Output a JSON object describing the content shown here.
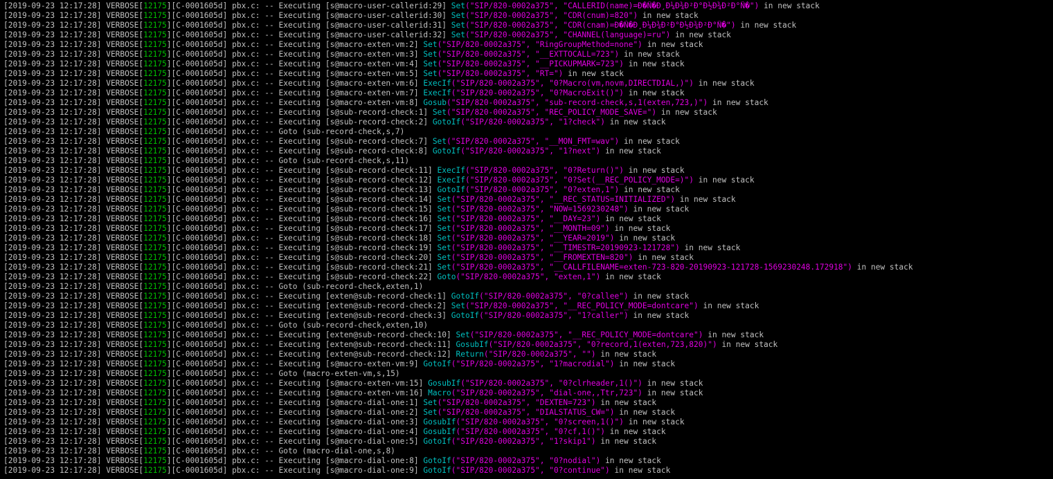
{
  "colors": {
    "background": "#000000",
    "text": "#c0c0c0",
    "pid": "#00c000",
    "command": "#00c0c0",
    "arguments": "#e000e0"
  },
  "log": {
    "timestamp": "[2019-09-23 12:17:28]",
    "level": "VERBOSE",
    "pid": "12175",
    "channel_id": "[C-0001605d]",
    "source": "pbx.c:",
    "lines": [
      {
        "type": "exec",
        "ctx": "[s@macro-user-callerid:29]",
        "cmd": "Set",
        "args": "(\"SIP/820-0002a375\", \"CALLERID(name)=Ð�Ñ�Ð¸Ð¼Ð¾Ð²Ð°Ð½Ð¾Ð²Ð°Ñ�\")"
      },
      {
        "type": "exec",
        "ctx": "[s@macro-user-callerid:30]",
        "cmd": "Set",
        "args": "(\"SIP/820-0002a375\", \"CDR(cnum)=820\")"
      },
      {
        "type": "exec",
        "ctx": "[s@macro-user-callerid:31]",
        "cmd": "Set",
        "args": "(\"SIP/820-0002a375\", \"CDR(cnam)=Ð�Ñ�Ð¸Ð¼Ð¾Ð²Ð°Ð½Ð¾Ð²Ð°Ñ�\")"
      },
      {
        "type": "exec",
        "ctx": "[s@macro-user-callerid:32]",
        "cmd": "Set",
        "args": "(\"SIP/820-0002a375\", \"CHANNEL(language)=ru\")"
      },
      {
        "type": "exec",
        "ctx": "[s@macro-exten-vm:2]",
        "cmd": "Set",
        "args": "(\"SIP/820-0002a375\", \"RingGroupMethod=none\")"
      },
      {
        "type": "exec",
        "ctx": "[s@macro-exten-vm:3]",
        "cmd": "Set",
        "args": "(\"SIP/820-0002a375\", \"__EXTTOCALL=723\")"
      },
      {
        "type": "exec",
        "ctx": "[s@macro-exten-vm:4]",
        "cmd": "Set",
        "args": "(\"SIP/820-0002a375\", \"__PICKUPMARK=723\")"
      },
      {
        "type": "exec",
        "ctx": "[s@macro-exten-vm:5]",
        "cmd": "Set",
        "args": "(\"SIP/820-0002a375\", \"RT=\")"
      },
      {
        "type": "exec",
        "ctx": "[s@macro-exten-vm:6]",
        "cmd": "ExecIf",
        "args": "(\"SIP/820-0002a375\", \"0?Macro(vm,novm,DIRECTDIAL,)\")"
      },
      {
        "type": "exec",
        "ctx": "[s@macro-exten-vm:7]",
        "cmd": "ExecIf",
        "args": "(\"SIP/820-0002a375\", \"0?MacroExit()\")"
      },
      {
        "type": "exec",
        "ctx": "[s@macro-exten-vm:8]",
        "cmd": "Gosub",
        "args": "(\"SIP/820-0002a375\", \"sub-record-check,s,1(exten,723,)\")"
      },
      {
        "type": "exec",
        "ctx": "[s@sub-record-check:1]",
        "cmd": "Set",
        "args": "(\"SIP/820-0002a375\", \"REC_POLICY_MODE_SAVE=\")"
      },
      {
        "type": "exec",
        "ctx": "[s@sub-record-check:2]",
        "cmd": "GotoIf",
        "args": "(\"SIP/820-0002a375\", \"1?check\")"
      },
      {
        "type": "goto",
        "text": "Goto (sub-record-check,s,7)"
      },
      {
        "type": "exec",
        "ctx": "[s@sub-record-check:7]",
        "cmd": "Set",
        "args": "(\"SIP/820-0002a375\", \"__MON_FMT=wav\")"
      },
      {
        "type": "exec",
        "ctx": "[s@sub-record-check:8]",
        "cmd": "GotoIf",
        "args": "(\"SIP/820-0002a375\", \"1?next\")"
      },
      {
        "type": "goto",
        "text": "Goto (sub-record-check,s,11)"
      },
      {
        "type": "exec",
        "ctx": "[s@sub-record-check:11]",
        "cmd": "ExecIf",
        "args": "(\"SIP/820-0002a375\", \"0?Return()\")"
      },
      {
        "type": "exec",
        "ctx": "[s@sub-record-check:12]",
        "cmd": "ExecIf",
        "args": "(\"SIP/820-0002a375\", \"0?Set(__REC_POLICY_MODE=)\")"
      },
      {
        "type": "exec",
        "ctx": "[s@sub-record-check:13]",
        "cmd": "GotoIf",
        "args": "(\"SIP/820-0002a375\", \"0?exten,1\")"
      },
      {
        "type": "exec",
        "ctx": "[s@sub-record-check:14]",
        "cmd": "Set",
        "args": "(\"SIP/820-0002a375\", \"__REC_STATUS=INITIALIZED\")"
      },
      {
        "type": "exec",
        "ctx": "[s@sub-record-check:15]",
        "cmd": "Set",
        "args": "(\"SIP/820-0002a375\", \"NOW=1569230248\")"
      },
      {
        "type": "exec",
        "ctx": "[s@sub-record-check:16]",
        "cmd": "Set",
        "args": "(\"SIP/820-0002a375\", \"__DAY=23\")"
      },
      {
        "type": "exec",
        "ctx": "[s@sub-record-check:17]",
        "cmd": "Set",
        "args": "(\"SIP/820-0002a375\", \"__MONTH=09\")"
      },
      {
        "type": "exec",
        "ctx": "[s@sub-record-check:18]",
        "cmd": "Set",
        "args": "(\"SIP/820-0002a375\", \"__YEAR=2019\")"
      },
      {
        "type": "exec",
        "ctx": "[s@sub-record-check:19]",
        "cmd": "Set",
        "args": "(\"SIP/820-0002a375\", \"__TIMESTR=20190923-121728\")"
      },
      {
        "type": "exec",
        "ctx": "[s@sub-record-check:20]",
        "cmd": "Set",
        "args": "(\"SIP/820-0002a375\", \"__FROMEXTEN=820\")"
      },
      {
        "type": "exec",
        "ctx": "[s@sub-record-check:21]",
        "cmd": "Set",
        "args": "(\"SIP/820-0002a375\", \"__CALLFILENAME=exten-723-820-20190923-121728-1569230248.172918\")"
      },
      {
        "type": "exec",
        "ctx": "[s@sub-record-check:22]",
        "cmd": "Goto",
        "args": "(\"SIP/820-0002a375\", \"exten,1\")"
      },
      {
        "type": "goto",
        "text": "Goto (sub-record-check,exten,1)"
      },
      {
        "type": "exec",
        "ctx": "[exten@sub-record-check:1]",
        "cmd": "GotoIf",
        "args": "(\"SIP/820-0002a375\", \"0?callee\")"
      },
      {
        "type": "exec",
        "ctx": "[exten@sub-record-check:2]",
        "cmd": "Set",
        "args": "(\"SIP/820-0002a375\", \"__REC_POLICY_MODE=dontcare\")"
      },
      {
        "type": "exec",
        "ctx": "[exten@sub-record-check:3]",
        "cmd": "GotoIf",
        "args": "(\"SIP/820-0002a375\", \"1?caller\")"
      },
      {
        "type": "goto",
        "text": "Goto (sub-record-check,exten,10)"
      },
      {
        "type": "exec",
        "ctx": "[exten@sub-record-check:10]",
        "cmd": "Set",
        "args": "(\"SIP/820-0002a375\", \"__REC_POLICY_MODE=dontcare\")"
      },
      {
        "type": "exec",
        "ctx": "[exten@sub-record-check:11]",
        "cmd": "GosubIf",
        "args": "(\"SIP/820-0002a375\", \"0?record,1(exten,723,820)\")"
      },
      {
        "type": "exec",
        "ctx": "[exten@sub-record-check:12]",
        "cmd": "Return",
        "args": "(\"SIP/820-0002a375\", \"\")"
      },
      {
        "type": "exec",
        "ctx": "[s@macro-exten-vm:9]",
        "cmd": "GotoIf",
        "args": "(\"SIP/820-0002a375\", \"1?macrodial\")"
      },
      {
        "type": "goto",
        "text": "Goto (macro-exten-vm,s,15)"
      },
      {
        "type": "exec",
        "ctx": "[s@macro-exten-vm:15]",
        "cmd": "GosubIf",
        "args": "(\"SIP/820-0002a375\", \"0?clrheader,1()\")"
      },
      {
        "type": "exec",
        "ctx": "[s@macro-exten-vm:16]",
        "cmd": "Macro",
        "args": "(\"SIP/820-0002a375\", \"dial-one,,Ttr,723\")"
      },
      {
        "type": "exec",
        "ctx": "[s@macro-dial-one:1]",
        "cmd": "Set",
        "args": "(\"SIP/820-0002a375\", \"DEXTEN=723\")"
      },
      {
        "type": "exec",
        "ctx": "[s@macro-dial-one:2]",
        "cmd": "Set",
        "args": "(\"SIP/820-0002a375\", \"DIALSTATUS_CW=\")"
      },
      {
        "type": "exec",
        "ctx": "[s@macro-dial-one:3]",
        "cmd": "GosubIf",
        "args": "(\"SIP/820-0002a375\", \"0?screen,1()\")"
      },
      {
        "type": "exec",
        "ctx": "[s@macro-dial-one:4]",
        "cmd": "GosubIf",
        "args": "(\"SIP/820-0002a375\", \"0?cf,1()\")"
      },
      {
        "type": "exec",
        "ctx": "[s@macro-dial-one:5]",
        "cmd": "GotoIf",
        "args": "(\"SIP/820-0002a375\", \"1?skip1\")"
      },
      {
        "type": "goto",
        "text": "Goto (macro-dial-one,s,8)"
      },
      {
        "type": "exec",
        "ctx": "[s@macro-dial-one:8]",
        "cmd": "GotoIf",
        "args": "(\"SIP/820-0002a375\", \"0?nodial\")"
      },
      {
        "type": "exec",
        "ctx": "[s@macro-dial-one:9]",
        "cmd": "GotoIf",
        "args": "(\"SIP/820-0002a375\", \"0?continue\")"
      }
    ],
    "executing_label": "-- Executing",
    "goto_prefix": "--",
    "suffix": "in new stack"
  }
}
